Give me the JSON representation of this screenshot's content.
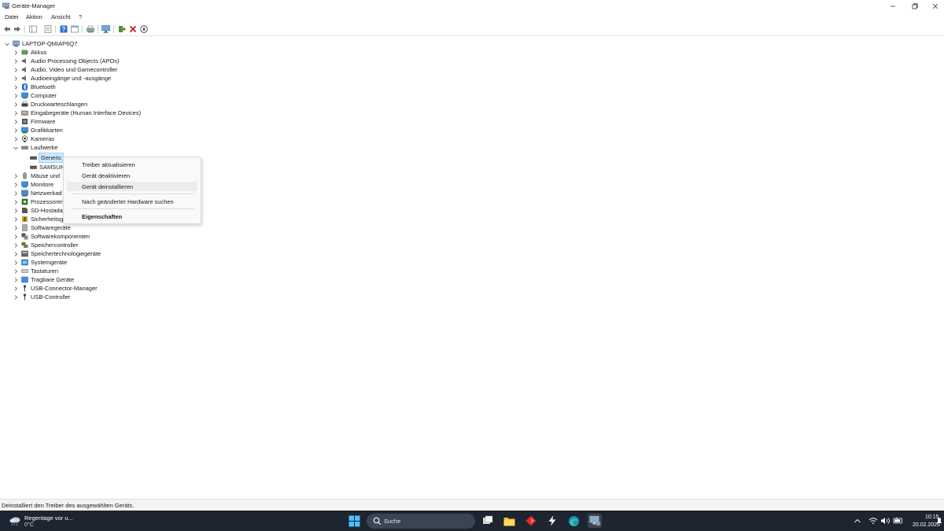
{
  "window": {
    "title": "Geräte-Manager"
  },
  "menu": [
    "Datei",
    "Aktion",
    "Ansicht",
    "?"
  ],
  "tree": {
    "root": "LAPTOP-QMIAP6Q7",
    "categories": [
      "Akkus",
      "Audio Processing Objects (APOs)",
      "Audio, Video und Gamecontroller",
      "Audioeingänge und -ausgänge",
      "Bluetooth",
      "Computer",
      "Druckwarteschlangen",
      "Eingabegeräte (Human Interface Devices)",
      "Firmware",
      "Grafikkarten",
      "Kameras",
      "Laufwerke",
      "Mäuse und",
      "Monitore",
      "Netzwerkad",
      "Prozessoren",
      "SD-Hostada",
      "Sicherheitsg",
      "Softwaregeräte",
      "Softwarekomponenten",
      "Speichercontroller",
      "Speichertechnologiegeräte",
      "Systemgeräte",
      "Tastaturen",
      "Tragbare Geräte",
      "USB-Connector-Manager",
      "USB-Controller"
    ],
    "laufwerke_children": [
      "Generic",
      "SAMSUN"
    ]
  },
  "context_menu": {
    "items": [
      "Treiber aktualisieren",
      "Gerät deaktivieren",
      "Gerät deinstallieren",
      "Nach geänderter Hardware suchen",
      "Eigenschaften"
    ],
    "highlighted": "Gerät deinstallieren"
  },
  "status": {
    "text": "Deinstalliert den Treiber des ausgewählten Geräts."
  },
  "taskbar": {
    "weather_line1": "Regentage vor u...",
    "weather_line2": "0°C",
    "search_placeholder": "Suche",
    "time": "10:15",
    "date": "20.02.2026"
  },
  "colors": {
    "taskbar_bg": "#1c2530",
    "selection": "#cce8ff",
    "folder_blue": "#2f6fd6"
  },
  "icons": [
    "device-manager-icon",
    "back-arrow-icon",
    "forward-arrow-icon",
    "properties-icon",
    "help-icon",
    "scan-hardware-icon",
    "update-driver-icon",
    "uninstall-icon",
    "disable-icon",
    "windows-start-icon",
    "search-icon",
    "file-explorer-icon",
    "edge-icon",
    "wifi-icon",
    "volume-icon",
    "battery-icon"
  ]
}
